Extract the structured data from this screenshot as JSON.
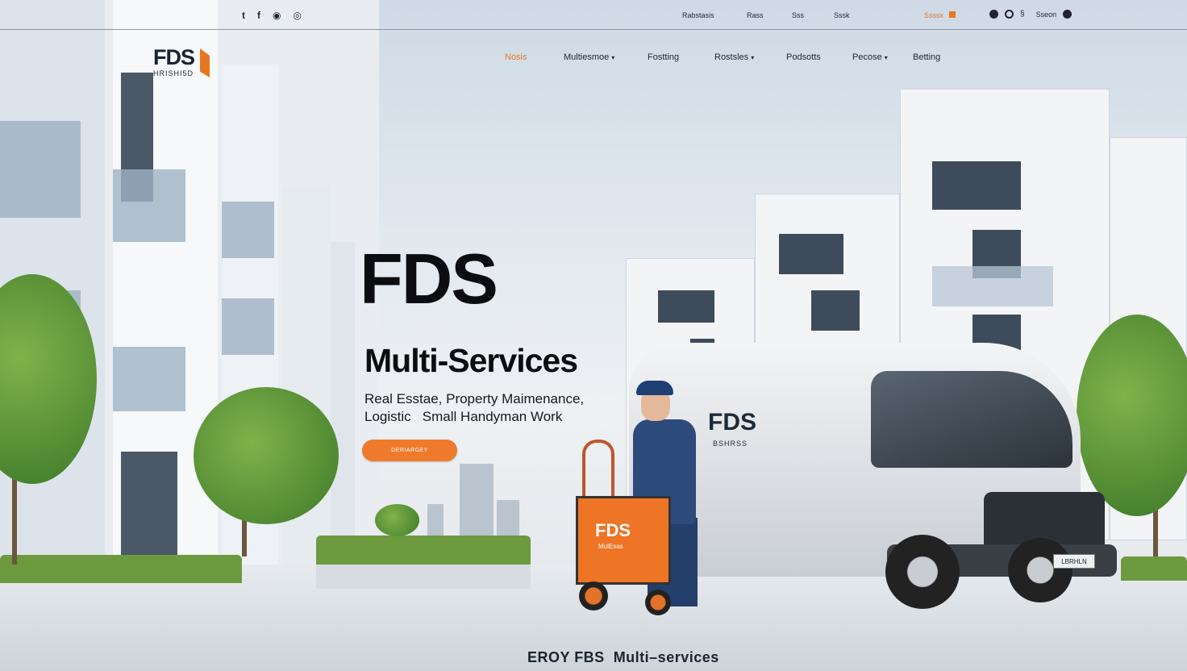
{
  "topbar": {
    "social": [
      "t",
      "f",
      "◉",
      "◎"
    ],
    "links": [
      "Rabstasis",
      "Rass",
      "Sss",
      "Sssk"
    ],
    "signin_label": "Ssssx",
    "right_label": "Sseon"
  },
  "logo": {
    "mark": "FDS",
    "tagline": "HRISHI5D"
  },
  "nav": {
    "items": [
      {
        "label": "Nosis",
        "active": true
      },
      {
        "label": "Multiesmoe",
        "dropdown": true
      },
      {
        "label": "Fostting"
      },
      {
        "label": "Rostsles",
        "dropdown": true
      },
      {
        "label": "Podsotts"
      },
      {
        "label": "Pecose",
        "dropdown": true
      },
      {
        "label": "Betting"
      }
    ]
  },
  "hero": {
    "title": "FDS",
    "subtitle": "Multi-Services",
    "desc_line1": "Real Esstae, Property Maimenance,",
    "desc_line2": "Logistic   Small Handyman Work",
    "cta_label": "DERIARGEY"
  },
  "van": {
    "brand": "FDS",
    "brand_sub": "BSHRSS",
    "plate": "LBRHLN"
  },
  "cart": {
    "label": "FDS",
    "sub": "MulEsas"
  },
  "footer": {
    "tagline": "EROY FBS  Multi–services"
  },
  "colors": {
    "accent": "#e87722",
    "text": "#111111",
    "sky": "#cfdae6"
  }
}
